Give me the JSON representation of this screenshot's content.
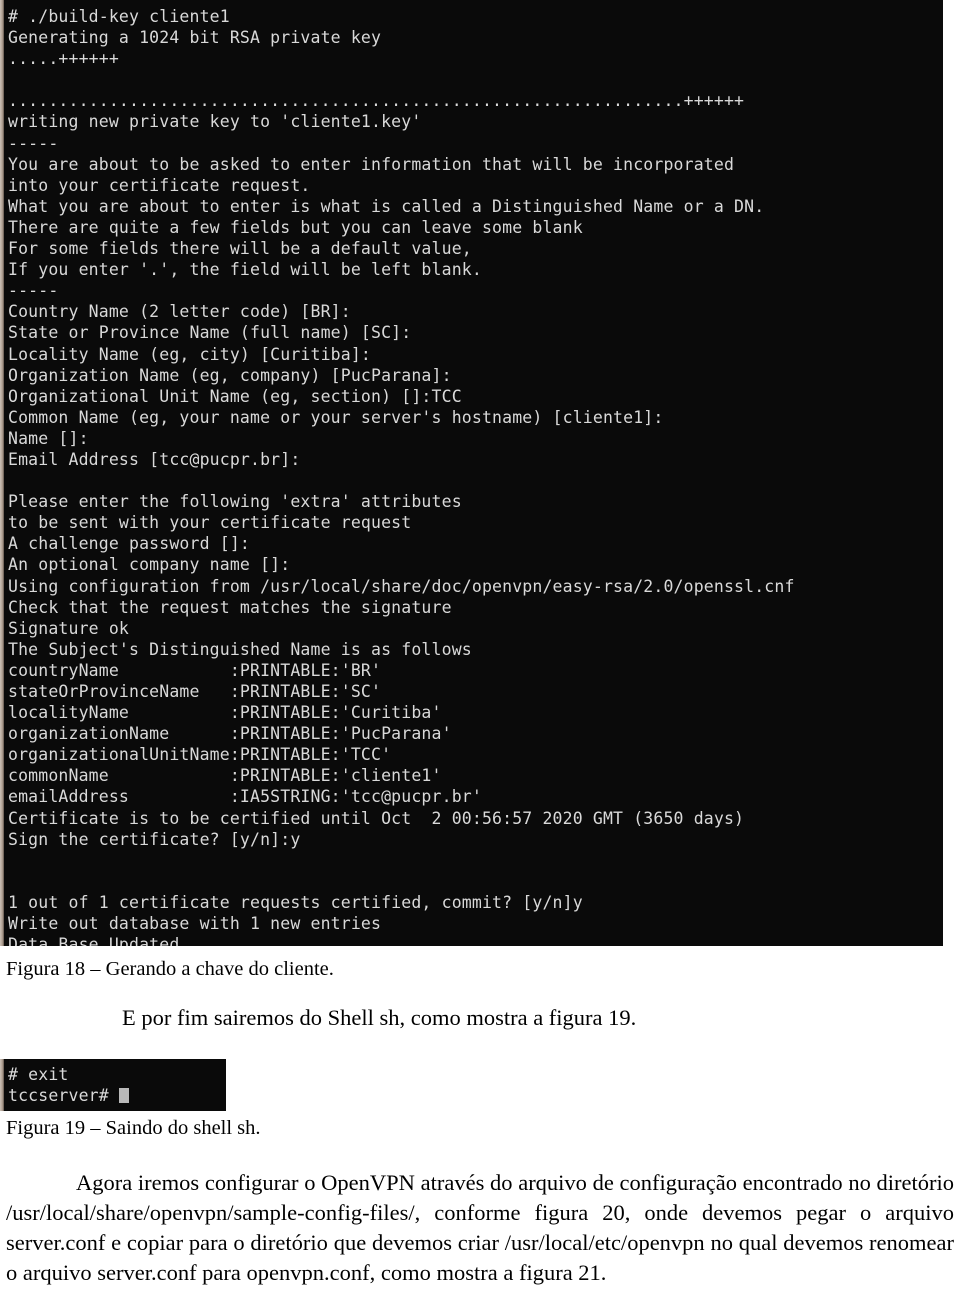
{
  "document": {
    "language": "pt-BR",
    "figures": [
      {
        "id": "figura-18",
        "caption": "Figura 18 – Gerando a chave do cliente."
      },
      {
        "id": "figura-19",
        "caption": "Figura 19 – Saindo do shell sh."
      }
    ],
    "paragraphs": {
      "exit_shell": "E por fim sairemos do Shell sh, como mostra a figura 19.",
      "openvpn_config": "Agora iremos configurar o OpenVPN através do arquivo de configuração encontrado no diretório /usr/local/share/openvpn/sample-config-files/, conforme figura 20, onde devemos pegar o arquivo server.conf e copiar para o diretório que devemos criar /usr/local/etc/openvpn no qual devemos renomear o arquivo server.conf para openvpn.conf, como mostra a figura 21."
    }
  },
  "terminal_main": {
    "name": "build-key-cliente1-terminal",
    "background": "#0a0a0a",
    "foreground": "#d9d9d9",
    "lines": [
      "# ./build-key cliente1",
      "Generating a 1024 bit RSA private key",
      ".....++++++",
      "",
      "...................................................................++++++",
      "writing new private key to 'cliente1.key'",
      "-----",
      "You are about to be asked to enter information that will be incorporated",
      "into your certificate request.",
      "What you are about to enter is what is called a Distinguished Name or a DN.",
      "There are quite a few fields but you can leave some blank",
      "For some fields there will be a default value,",
      "If you enter '.', the field will be left blank.",
      "-----",
      "Country Name (2 letter code) [BR]:",
      "State or Province Name (full name) [SC]:",
      "Locality Name (eg, city) [Curitiba]:",
      "Organization Name (eg, company) [PucParana]:",
      "Organizational Unit Name (eg, section) []:TCC",
      "Common Name (eg, your name or your server's hostname) [cliente1]:",
      "Name []:",
      "Email Address [tcc@pucpr.br]:",
      "",
      "Please enter the following 'extra' attributes",
      "to be sent with your certificate request",
      "A challenge password []:",
      "An optional company name []:",
      "Using configuration from /usr/local/share/doc/openvpn/easy-rsa/2.0/openssl.cnf",
      "Check that the request matches the signature",
      "Signature ok",
      "The Subject's Distinguished Name is as follows",
      "countryName           :PRINTABLE:'BR'",
      "stateOrProvinceName   :PRINTABLE:'SC'",
      "localityName          :PRINTABLE:'Curitiba'",
      "organizationName      :PRINTABLE:'PucParana'",
      "organizationalUnitName:PRINTABLE:'TCC'",
      "commonName            :PRINTABLE:'cliente1'",
      "emailAddress          :IA5STRING:'tcc@pucpr.br'",
      "Certificate is to be certified until Oct  2 00:56:57 2020 GMT (3650 days)",
      "Sign the certificate? [y/n]:y",
      "",
      "",
      "1 out of 1 certificate requests certified, commit? [y/n]y",
      "Write out database with 1 new entries",
      "Data Base Updated",
      "#"
    ]
  },
  "terminal_exit": {
    "name": "exit-shell-terminal",
    "background": "#0a0a0a",
    "foreground": "#d9d9d9",
    "lines": [
      "# exit",
      "tccserver#"
    ],
    "cursor": "block-cursor"
  }
}
